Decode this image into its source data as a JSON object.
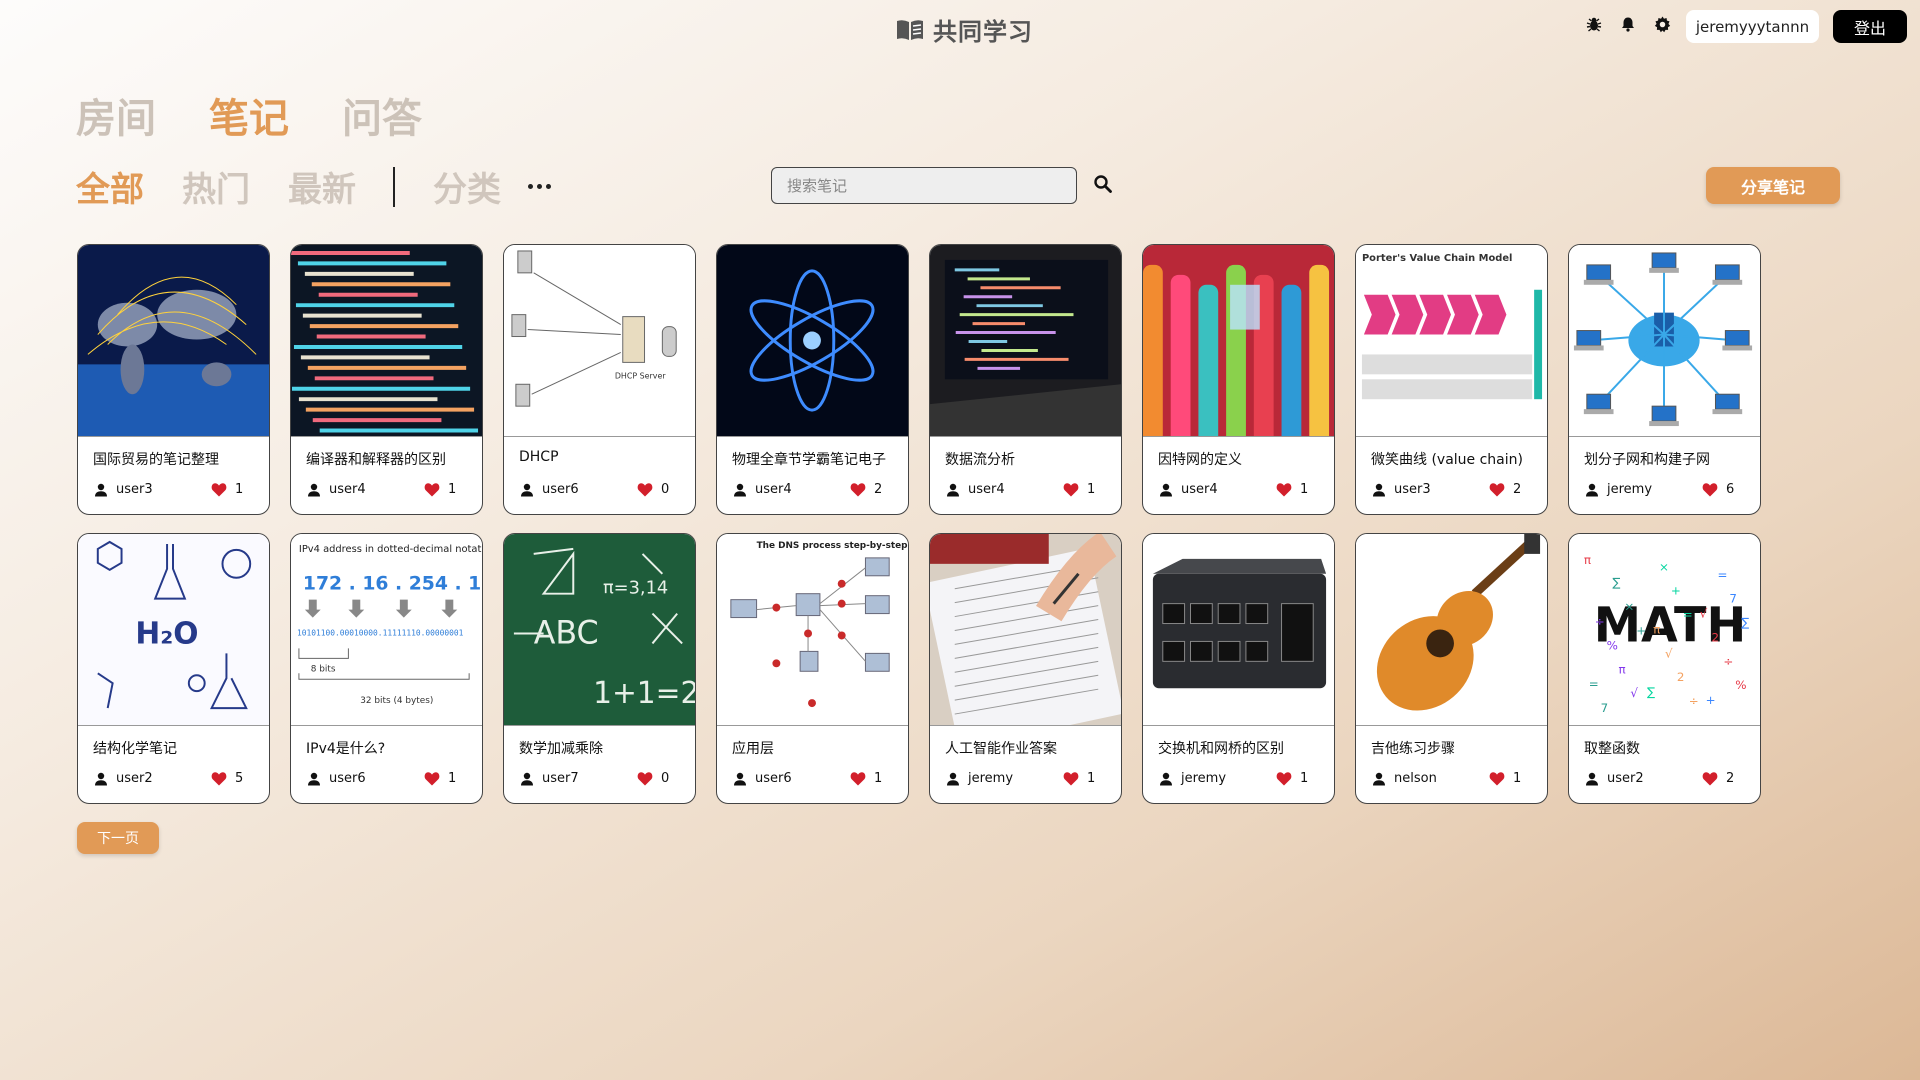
{
  "app": {
    "title": "共同学习",
    "username": "jeremyyytannn",
    "logout_label": "登出",
    "icons": [
      "bug-icon",
      "bell-icon",
      "gear-icon"
    ]
  },
  "main_tabs": [
    "房间",
    "笔记",
    "问答"
  ],
  "active_main_tab": 1,
  "sub_tabs": [
    "全部",
    "热门",
    "最新"
  ],
  "category_label": "分类",
  "active_sub_tab": 0,
  "search": {
    "placeholder": "搜索笔记",
    "value": ""
  },
  "share_label": "分享笔记",
  "next_label": "下一页",
  "colors": {
    "accent": "#e19a56",
    "heart": "#d21f2b"
  },
  "notes": [
    {
      "title": "国际贸易的笔记整理",
      "user": "user3",
      "likes": 1,
      "thumb": "world-map-image"
    },
    {
      "title": "编译器和解释器的区别",
      "user": "user4",
      "likes": 1,
      "thumb": "code-screen-image"
    },
    {
      "title": "DHCP",
      "user": "user6",
      "likes": 0,
      "thumb": "dhcp-diagram-image"
    },
    {
      "title": "物理全章节学霸笔记电子",
      "user": "user4",
      "likes": 2,
      "thumb": "atom-image"
    },
    {
      "title": "数据流分析",
      "user": "user4",
      "likes": 1,
      "thumb": "laptop-code-image"
    },
    {
      "title": "因特网的定义",
      "user": "user4",
      "likes": 1,
      "thumb": "network-cables-image"
    },
    {
      "title": "微笑曲线 (value chain)",
      "user": "user3",
      "likes": 2,
      "thumb": "value-chain-image"
    },
    {
      "title": "划分子网和构建子网",
      "user": "jeremy",
      "likes": 6,
      "thumb": "network-topology-image"
    },
    {
      "title": "结构化学笔记",
      "user": "user2",
      "likes": 5,
      "thumb": "chemistry-doodle-image"
    },
    {
      "title": "IPv4是什么?",
      "user": "user6",
      "likes": 1,
      "thumb": "ipv4-diagram-image"
    },
    {
      "title": "数学加减乘除",
      "user": "user7",
      "likes": 0,
      "thumb": "chalkboard-math-image"
    },
    {
      "title": "应用层",
      "user": "user6",
      "likes": 1,
      "thumb": "dns-diagram-image"
    },
    {
      "title": "人工智能作业答案",
      "user": "jeremy",
      "likes": 1,
      "thumb": "handwriting-image"
    },
    {
      "title": "交换机和网桥的区别",
      "user": "jeremy",
      "likes": 1,
      "thumb": "switch-image"
    },
    {
      "title": "吉他练习步骤",
      "user": "nelson",
      "likes": 1,
      "thumb": "guitar-image"
    },
    {
      "title": "取整函数",
      "user": "user2",
      "likes": 2,
      "thumb": "math-word-image"
    }
  ]
}
